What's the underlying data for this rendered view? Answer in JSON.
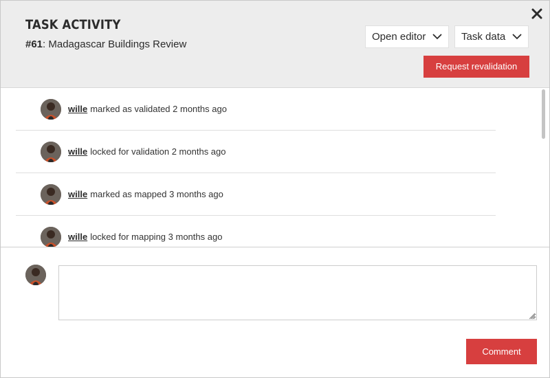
{
  "header": {
    "title": "TASK ACTIVITY",
    "task_number": "#61",
    "task_name": ": Madagascar Buildings Review",
    "open_editor_label": "Open editor",
    "task_data_label": "Task data",
    "request_revalidation_label": "Request revalidation"
  },
  "activity": {
    "items": [
      {
        "user": "wille",
        "action": "marked as validated",
        "when": "2 months ago"
      },
      {
        "user": "wille",
        "action": "locked for validation",
        "when": "2 months ago"
      },
      {
        "user": "wille",
        "action": "marked as mapped",
        "when": "3 months ago"
      },
      {
        "user": "wille",
        "action": "locked for mapping",
        "when": "3 months ago"
      }
    ]
  },
  "comment": {
    "value": "",
    "placeholder": "",
    "submit_label": "Comment"
  },
  "colors": {
    "accent": "#d73f3f",
    "header_bg": "#ededed"
  },
  "icons": {
    "close": "close-icon",
    "dropdown": "chevron-down-icon",
    "avatar": "user-avatar"
  }
}
